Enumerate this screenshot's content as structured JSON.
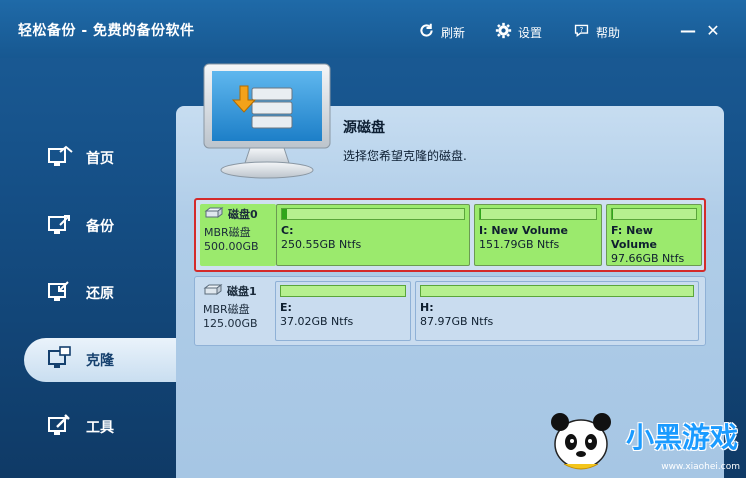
{
  "app": {
    "title": "轻松备份 - 免费的备份软件"
  },
  "toolbar": {
    "refresh_label": "刷新",
    "settings_label": "设置",
    "help_label": "帮助",
    "minimize": "—",
    "close": "✕"
  },
  "sidebar": {
    "items": [
      {
        "label": "首页",
        "icon": "home-icon"
      },
      {
        "label": "备份",
        "icon": "backup-icon"
      },
      {
        "label": "还原",
        "icon": "restore-icon"
      },
      {
        "label": "克隆",
        "icon": "clone-icon",
        "active": true
      },
      {
        "label": "工具",
        "icon": "tools-icon"
      }
    ]
  },
  "main": {
    "title": "源磁盘",
    "subtitle": "选择您希望克隆的磁盘."
  },
  "disks": [
    {
      "name": "磁盘0",
      "type": "MBR磁盘",
      "size": "500.00GB",
      "selected": true,
      "partitions": [
        {
          "name": "C:",
          "size": "250.55GB Ntfs",
          "used": 0.03
        },
        {
          "name": "I: New Volume",
          "size": "151.79GB Ntfs",
          "used": 0.01
        },
        {
          "name": "F: New Volume",
          "size": "97.66GB Ntfs",
          "used": 0.01
        }
      ]
    },
    {
      "name": "磁盘1",
      "type": "MBR磁盘",
      "size": "125.00GB",
      "selected": false,
      "partitions": [
        {
          "name": "E:",
          "size": "37.02GB Ntfs",
          "used": 0.0
        },
        {
          "name": "H:",
          "size": "87.97GB Ntfs",
          "used": 0.0
        }
      ]
    }
  ],
  "watermark": {
    "big": "小黑游戏",
    "url": "www.xiaohei.com"
  },
  "colors": {
    "accent": "#1b5d98",
    "partition_green": "#9bea6d",
    "selected_border": "#d42a2a"
  }
}
